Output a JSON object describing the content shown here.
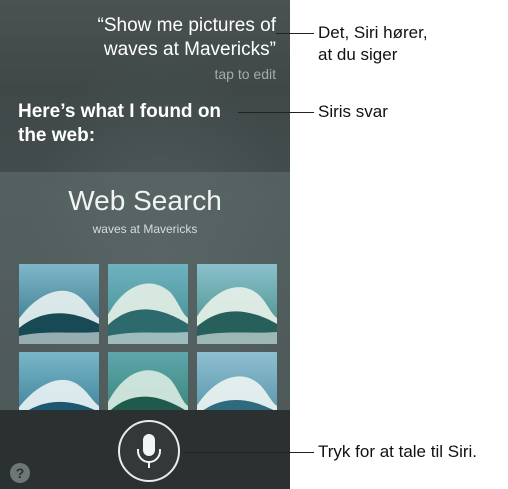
{
  "siri": {
    "utterance_line1": "“Show me pictures of",
    "utterance_line2": "waves at Mavericks”",
    "tap_to_edit": "tap to edit",
    "response_line1": "Here’s what I found on",
    "response_line2": "the web:",
    "web_search_title": "Web Search",
    "web_search_query": "waves at Mavericks",
    "help_label": "?",
    "mic_icon": "microphone-icon"
  },
  "thumbnails": [
    {
      "colors": [
        "#7fb7c9",
        "#2b6f7f",
        "#e8f1ef",
        "#174a55"
      ]
    },
    {
      "colors": [
        "#6fb2c0",
        "#3d8b8a",
        "#e4efe6",
        "#2c6a6d"
      ]
    },
    {
      "colors": [
        "#8cc0cc",
        "#3c8a7f",
        "#e9f2ea",
        "#275f5a"
      ]
    },
    {
      "colors": [
        "#7ab6c8",
        "#2e7590",
        "#eaf3f4",
        "#1e5870"
      ]
    },
    {
      "colors": [
        "#5ea6ab",
        "#2f7d6e",
        "#d9ebe2",
        "#1f5a4d"
      ]
    },
    {
      "colors": [
        "#8ebfd0",
        "#4a8aa0",
        "#eef5f3",
        "#2f6b7c"
      ]
    }
  ],
  "callouts": {
    "heard_line1": "Det, Siri hører,",
    "heard_line2": "at du siger",
    "answer": "Siris svar",
    "tap_to_speak": "Tryk for at tale til Siri."
  }
}
